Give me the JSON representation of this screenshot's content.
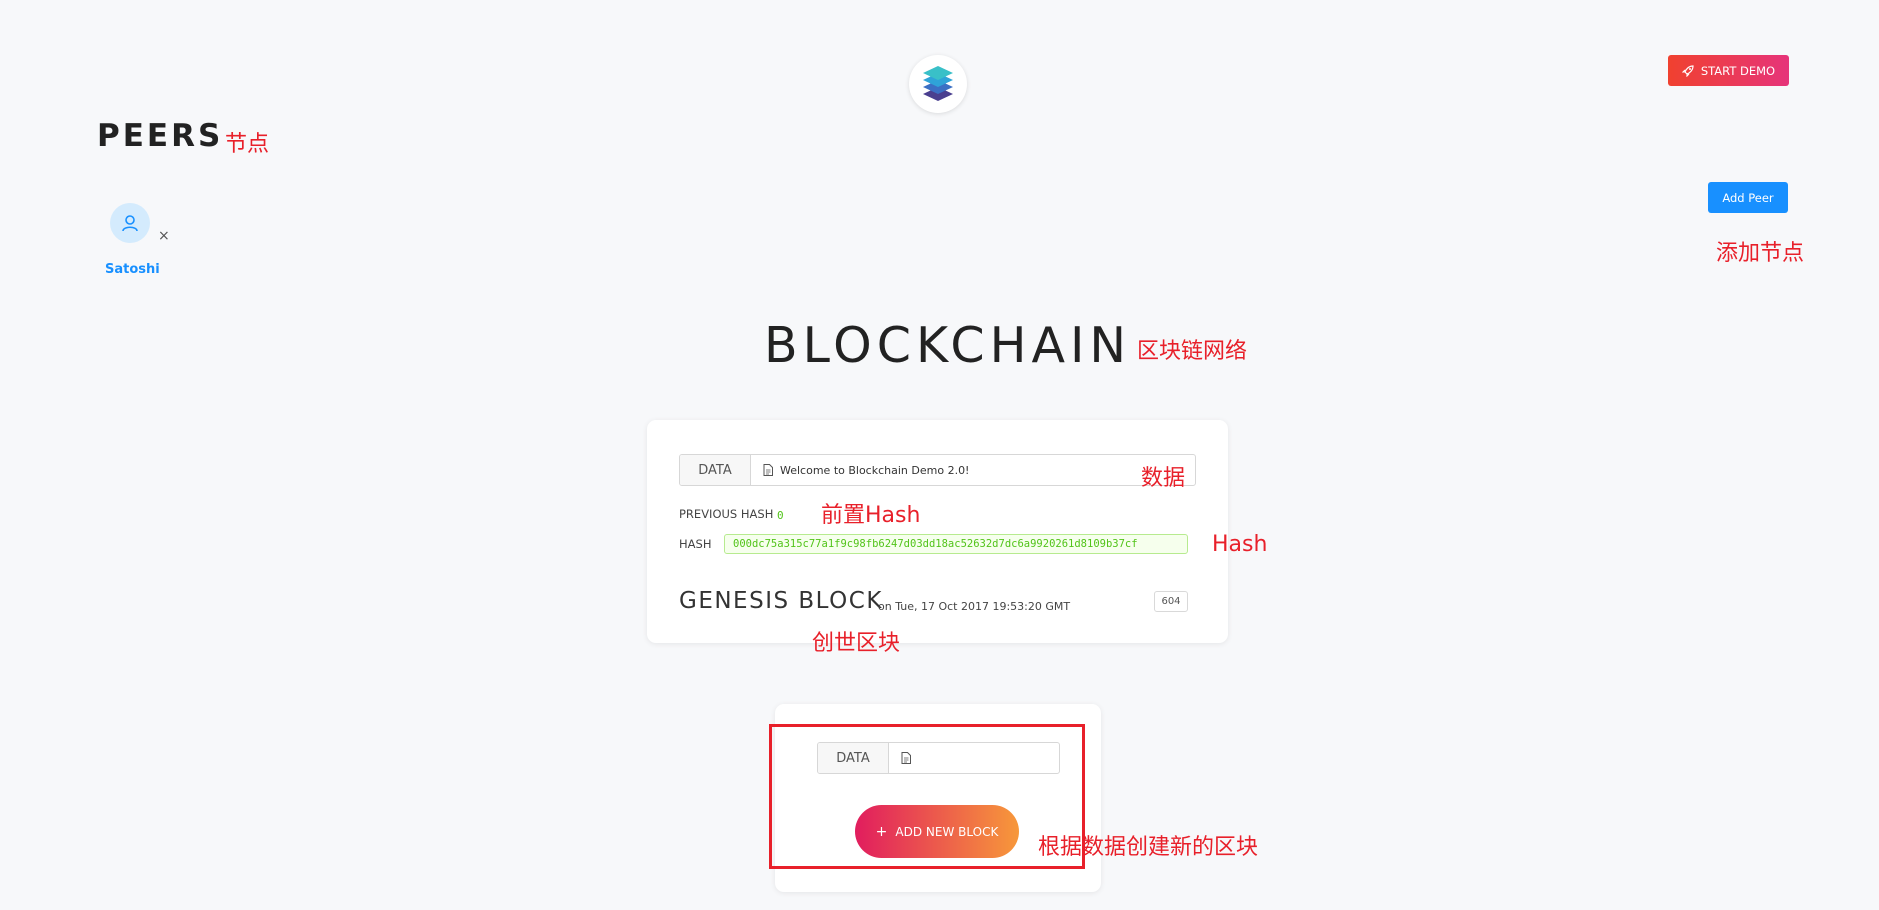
{
  "header": {
    "start_demo_label": "START DEMO",
    "logo_icon": "layers-logo-icon"
  },
  "peers": {
    "title": "PEERS",
    "title_annotation": "节点",
    "add_peer_label": "Add Peer",
    "add_peer_annotation": "添加节点",
    "items": [
      {
        "name": "Satoshi",
        "icon": "user-icon"
      }
    ]
  },
  "blockchain": {
    "title": "BLOCKCHAIN",
    "title_annotation": "区块链网络",
    "genesis": {
      "data_label": "DATA",
      "data_value": "Welcome to Blockchain Demo 2.0!",
      "data_annotation": "数据",
      "previous_hash_label": "PREVIOUS HASH",
      "previous_hash_value": "0",
      "previous_hash_annotation": "前置Hash",
      "hash_label": "HASH",
      "hash_value": "000dc75a315c77a1f9c98fb6247d03dd18ac52632d7dc6a9920261d8109b37cf",
      "hash_annotation": "Hash",
      "block_title": "GENESIS BLOCK",
      "block_date": "on Tue, 17 Oct 2017 19:53:20 GMT",
      "nonce": "604",
      "block_annotation": "创世区块"
    },
    "new_block": {
      "data_label": "DATA",
      "data_value": "",
      "add_button_label": "ADD NEW BLOCK",
      "annotation": "根据数据创建新的区块"
    }
  },
  "colors": {
    "primary_blue": "#1890ff",
    "hash_green": "#52c41a",
    "annotation_red": "#e8202a"
  }
}
